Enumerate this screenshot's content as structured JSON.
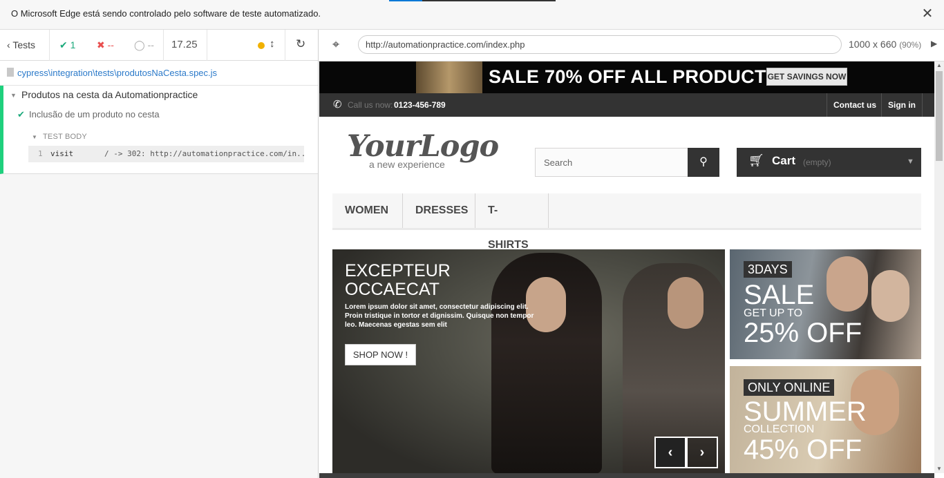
{
  "notice": {
    "message": "O Microsoft Edge está sendo controlado pelo software de teste automatizado.",
    "close_glyph": "✕"
  },
  "reporter": {
    "tests_label": "Tests",
    "passed_count": "1",
    "failed_count": "--",
    "pending_count": "--",
    "duration": "17.25",
    "spec_path": "cypress\\integration\\tests\\produtosNaCesta.spec.js",
    "suite_title": "Produtos na cesta da Automationpractice",
    "test_title": "Inclusão de um produto no cesta",
    "body_label": "TEST BODY",
    "command": {
      "number": "1",
      "name": "visit",
      "message": "/ -> 302: http://automationpractice.com/in..."
    },
    "colors": {
      "passed": "#1ba97b",
      "failed": "#e94f4f",
      "running": "#f1b100"
    }
  },
  "aut": {
    "url": "http://automationpractice.com/index.php",
    "viewport": "1000 x 660",
    "scale": "(90%)"
  },
  "site": {
    "promo_text": "SALE 70% OFF ALL PRODUCTS",
    "promo_button": "GET SAVINGS NOW",
    "call_label": "Call us now:",
    "call_number": "0123-456-789",
    "contact_link": "Contact us",
    "signin_link": "Sign in",
    "logo_brand": "YourLogo",
    "logo_tagline": "a new experience",
    "search_placeholder": "Search",
    "cart_label": "Cart",
    "cart_status": "(empty)",
    "menu": [
      "WOMEN",
      "DRESSES",
      "T-SHIRTS"
    ],
    "slider": {
      "headline_line1": "EXCEPTEUR",
      "headline_line2": "OCCAECAT",
      "text": "Lorem ipsum dolor sit amet, consectetur adipiscing elit. Proin tristique in tortor et dignissim. Quisque non tempor leo. Maecenas egestas sem elit",
      "button": "SHOP NOW !"
    },
    "banner1": {
      "tag": "3DAYS",
      "title": "SALE",
      "subtitle": "GET UP TO",
      "offer": "25% OFF"
    },
    "banner2": {
      "tag": "ONLY ONLINE",
      "title": "SUMMER",
      "subtitle": "COLLECTION",
      "offer": "45% OFF"
    }
  }
}
